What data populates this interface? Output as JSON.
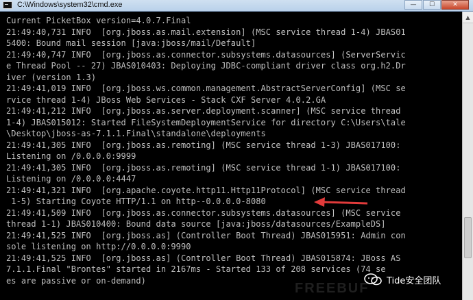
{
  "window": {
    "title": "C:\\Windows\\system32\\cmd.exe",
    "minimize_glyph": "—",
    "maximize_glyph": "☐",
    "close_glyph": "✕"
  },
  "console": {
    "lines": [
      "Current PicketBox version=4.0.7.Final",
      "21:49:40,731 INFO  [org.jboss.as.mail.extension] (MSC service thread 1-4) JBAS01",
      "5400: Bound mail session [java:jboss/mail/Default]",
      "21:49:40,747 INFO  [org.jboss.as.connector.subsystems.datasources] (ServerServic",
      "e Thread Pool -- 27) JBAS010403: Deploying JDBC-compliant driver class org.h2.Dr",
      "iver (version 1.3)",
      "21:49:41,019 INFO  [org.jboss.ws.common.management.AbstractServerConfig] (MSC se",
      "rvice thread 1-4) JBoss Web Services - Stack CXF Server 4.0.2.GA",
      "21:49:41,212 INFO  [org.jboss.as.server.deployment.scanner] (MSC service thread",
      "1-4) JBAS015012: Started FileSystemDeploymentService for directory C:\\Users\\tale",
      "\\Desktop\\jboss-as-7.1.1.Final\\standalone\\deployments",
      "21:49:41,305 INFO  [org.jboss.as.remoting] (MSC service thread 1-3) JBAS017100:",
      "Listening on /0.0.0.0:9999",
      "21:49:41,305 INFO  [org.jboss.as.remoting] (MSC service thread 1-1) JBAS017100:",
      "Listening on /0.0.0.0:4447",
      "21:49:41,321 INFO  [org.apache.coyote.http11.Http11Protocol] (MSC service thread",
      " 1-5) Starting Coyote HTTP/1.1 on http--0.0.0.0-8080",
      "21:49:41,509 INFO  [org.jboss.as.connector.subsystems.datasources] (MSC service",
      "thread 1-1) JBAS010400: Bound data source [java:jboss/datasources/ExampleDS]",
      "21:49:41,525 INFO  [org.jboss.as] (Controller Boot Thread) JBAS015951: Admin con",
      "sole listening on http://0.0.0.0:9990",
      "21:49:41,525 INFO  [org.jboss.as] (Controller Boot Thread) JBAS015874: JBoss AS",
      "7.1.1.Final \"Brontes\" started in 2167ms - Started 133 of 208 services (74 se",
      "es are passive or on-demand)"
    ]
  },
  "watermark": {
    "text": "Tide安全团队",
    "faint": "FREEBUF"
  },
  "colors": {
    "console_bg": "#000000",
    "console_text": "#c0c0c0",
    "annotation_arrow": "#e23b3b"
  },
  "icons": {
    "title": "console-icon",
    "annotation": "red-arrow-icon",
    "watermark": "wechat-icon"
  }
}
